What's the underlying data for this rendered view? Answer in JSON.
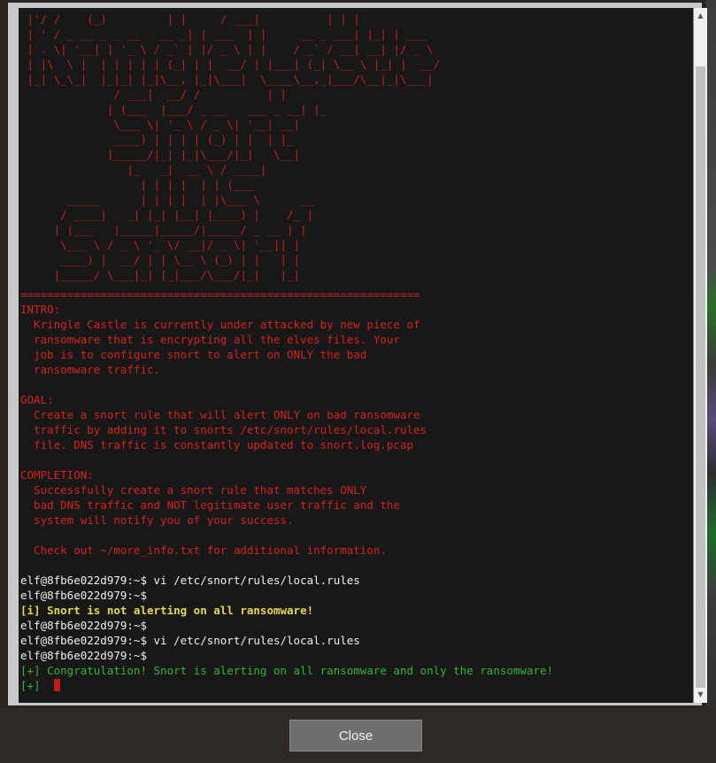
{
  "terminal": {
    "banner_art": " |'/ /    (_)         | |     / ___|          | | |\n | ' / _ __ _ _ __   __ _| | ___  | |     __ _ ___| |_| | ___\n | . \\| '__| | '_ \\ / _` | |/ _ \\ | |    / _` / __| __| |/ _ \\\n | |\\  \\ |  | | | | | (_| | |  __/ | |___| (_| \\__ \\ |_| |  __/\n |_| \\_\\_|  |_|_| |_|\\__, |_|\\___|  \\____\\__,_|___/\\__|_|\\___|\n              / ___|  __/ /          | |\n             | (___  |___/ _ __   ___ _ __| |_\n              \\___ \\| '_ \\ / _ \\| '__| __|\n              ____) | | | | (_) | |  | |_\n             |_____/|_| |_|\\___/|_|   \\__|\n                |_   _|  __ \\ / ____|\n                  | | | |  | | (___\n       _____      | | | |  | |\\___ \\      __\n      / ____|   _| |_| |__| |____) |    /_ |\n     | (___   |_____|_____/|_____/ _ __ | |\n      \\___ \\ / _ \\ '_ \\/ __|/ _ \\| '__|| |\n      ____) |  __/ | | \\__ \\ (_) | |   | |\n     |_____/ \\___|_| |_|___/\\___/|_|   |_|",
    "divider": "============================================================",
    "intro_heading": "INTRO:",
    "intro_body": "  Kringle Castle is currently under attacked by new piece of\n  ransomware that is encrypting all the elves files. Your\n  job is to configure snort to alert on ONLY the bad\n  ransomware traffic.",
    "goal_heading": "GOAL:",
    "goal_body": "  Create a snort rule that will alert ONLY on bad ransomware\n  traffic by adding it to snorts /etc/snort/rules/local.rules\n  file. DNS traffic is constantly updated to snort.log.pcap",
    "completion_heading": "COMPLETION:",
    "completion_body": "  Successfully create a snort rule that matches ONLY\n  bad DNS traffic and NOT legitimate user traffic and the\n  system will notify you of your success.",
    "more_info": "  Check out ~/more_info.txt for additional information.",
    "lines": [
      "elf@8fb6e022d979:~$ vi /etc/snort/rules/local.rules",
      "elf@8fb6e022d979:~$",
      "[i] Snort is not alerting on all ransomware!",
      "elf@8fb6e022d979:~$",
      "elf@8fb6e022d979:~$ vi /etc/snort/rules/local.rules",
      "elf@8fb6e022d979:~$",
      "[+] Congratulation! Snort is alerting on all ransomware and only the ransomware!",
      "[+]"
    ]
  },
  "buttons": {
    "close_label": "Close"
  },
  "colors": {
    "terminal_bg": "#181818",
    "banner_red": "#c8231e",
    "prompt_white": "#f0f0f0",
    "warning_yellow": "#e8d84a",
    "success_green": "#36b43a",
    "cursor_red": "#c21b1b"
  },
  "icons": {
    "scroll_up": "triangle-up-icon",
    "scroll_down": "triangle-down-icon"
  }
}
